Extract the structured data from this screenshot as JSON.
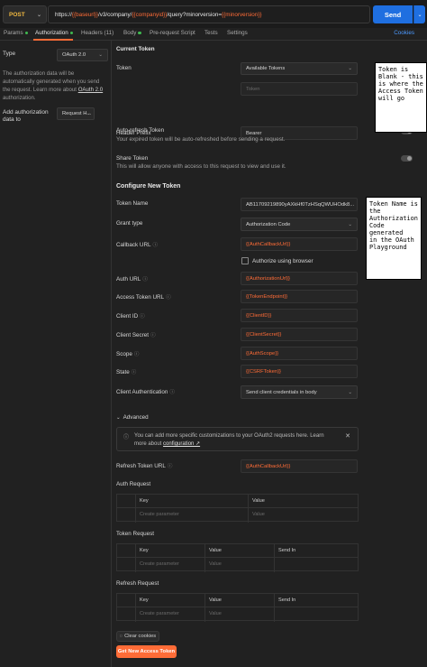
{
  "request": {
    "method": "POST",
    "url_parts": [
      {
        "text": "https://",
        "var": false
      },
      {
        "text": "{{baseurl}}",
        "var": true
      },
      {
        "text": "/v3/company/",
        "var": false
      },
      {
        "text": "{{companyid}}",
        "var": true
      },
      {
        "text": "/query?minorversion=",
        "var": false
      },
      {
        "text": "{{minorversion}}",
        "var": true
      }
    ],
    "send_label": "Send"
  },
  "tabs": {
    "params": "Params",
    "authorization": "Authorization",
    "headers": "Headers (11)",
    "body": "Body",
    "pre_request": "Pre-request Script",
    "tests": "Tests",
    "settings": "Settings",
    "cookies": "Cookies"
  },
  "left": {
    "type_label": "Type",
    "type_value": "OAuth 2.0",
    "desc_part1": "The authorization data will be automatically generated when you send the request. Learn more about ",
    "desc_link": "OAuth 2.0",
    "desc_part2": " authorization.",
    "add_to_label": "Add authorization data to",
    "add_to_value": "Request H..."
  },
  "current_token": {
    "heading": "Current Token",
    "token_label": "Token",
    "token_select": "Available Tokens",
    "token_placeholder": "Token",
    "header_prefix_label": "Header Prefix",
    "header_prefix_value": "Bearer",
    "auto_refresh_title": "Auto-refresh Token",
    "auto_refresh_desc": "Your expired token will be auto-refreshed before sending a request.",
    "share_title": "Share Token",
    "share_desc": "This will allow anyone with access to this request to view and use it."
  },
  "configure": {
    "heading": "Configure New Token",
    "token_name_label": "Token Name",
    "token_name_value": "AB11709219890yAXkHf0TzHSqQWUHOdk8...",
    "grant_type_label": "Grant type",
    "grant_type_value": "Authorization Code",
    "callback_label": "Callback URL",
    "callback_value": "{{AuthCallbackUrl}}",
    "authorize_browser": "Authorize using browser",
    "auth_url_label": "Auth URL",
    "auth_url_value": "{{AuthorizationUrl}}",
    "access_token_url_label": "Access Token URL",
    "access_token_url_value": "{{TokenEndpoint}}",
    "client_id_label": "Client ID",
    "client_id_value": "{{ClientID}}",
    "client_secret_label": "Client Secret",
    "client_secret_value": "{{ClientSecret}}",
    "scope_label": "Scope",
    "scope_value": "{{AuthScope}}",
    "state_label": "State",
    "state_value": "{{CSRFToken}}",
    "client_auth_label": "Client Authentication",
    "client_auth_value": "Send client credentials in body"
  },
  "advanced": {
    "toggle_label": "Advanced",
    "info_text": "You can add more specific customizations to your OAuth2 requests here. Learn more about ",
    "info_link": "configuration ↗",
    "refresh_url_label": "Refresh Token URL",
    "refresh_url_value": "{{AuthCallbackUrl}}",
    "auth_request_label": "Auth Request",
    "token_request_label": "Token Request",
    "refresh_request_label": "Refresh Request",
    "col_key": "Key",
    "col_value": "Value",
    "col_send_in": "Send In",
    "key_placeholder": "Create parameter",
    "value_placeholder": "Value"
  },
  "footer": {
    "clear_cookies": "Clear cookies",
    "get_token": "Get New Access Token"
  },
  "annotations": {
    "note1": "Token is\nBlank - this\nis where the\nAccess Token\nwill go",
    "note2": "Token Name is\nthe\nAuthorization\nCode generated\nin the OAuth\nPlayground"
  },
  "colors": {
    "accent": "#ff6c37",
    "send": "#1f6fe0",
    "link": "#4c9aff",
    "background": "#212121"
  }
}
